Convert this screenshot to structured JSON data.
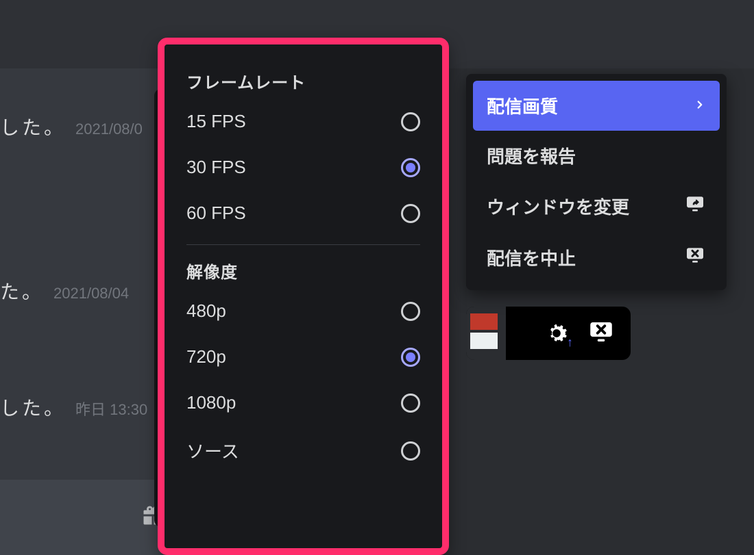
{
  "background_messages": [
    {
      "text": "した。",
      "timestamp": "2021/08/0"
    },
    {
      "text": "た。",
      "timestamp": "2021/08/04"
    },
    {
      "text": "した。",
      "timestamp": "昨日 13:30"
    }
  ],
  "quality_panel": {
    "framerate": {
      "header": "フレームレート",
      "options": [
        {
          "label": "15 FPS",
          "selected": false
        },
        {
          "label": "30 FPS",
          "selected": true
        },
        {
          "label": "60 FPS",
          "selected": false
        }
      ]
    },
    "resolution": {
      "header": "解像度",
      "options": [
        {
          "label": "480p",
          "selected": false
        },
        {
          "label": "720p",
          "selected": true
        },
        {
          "label": "1080p",
          "selected": false
        },
        {
          "label": "ソース",
          "selected": false
        }
      ]
    }
  },
  "context_menu": {
    "items": [
      {
        "label": "配信画質",
        "icon": "chevron-right",
        "active": true
      },
      {
        "label": "問題を報告",
        "icon": null,
        "active": false
      },
      {
        "label": "ウィンドウを変更",
        "icon": "share-screen",
        "active": false
      },
      {
        "label": "配信を中止",
        "icon": "stop-screen",
        "active": false
      }
    ]
  },
  "toolbar": {
    "settings_icon": "gear",
    "upgrade_arrow": "↑",
    "stop_icon": "stop-screen"
  },
  "highlight_color": "#ff2d6b",
  "accent_color": "#5865f2"
}
